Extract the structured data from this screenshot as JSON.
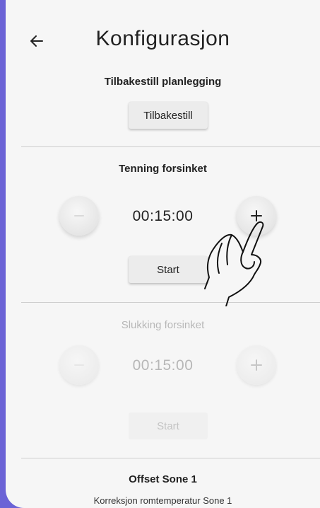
{
  "header": {
    "title": "Konfigurasjon"
  },
  "reset_schedule": {
    "title": "Tilbakestill planlegging",
    "button": "Tilbakestill"
  },
  "ignition_delay": {
    "title": "Tenning forsinket",
    "time": "00:15:00",
    "start": "Start"
  },
  "shutdown_delay": {
    "title": "Slukking forsinket",
    "time": "00:15:00",
    "start": "Start"
  },
  "offset": {
    "title": "Offset Sone 1",
    "subtitle": "Korreksjon romtemperatur Sone 1"
  },
  "colors": {
    "accent": "#6b63d6",
    "text": "#222222",
    "muted": "#b7b7b7",
    "background": "#f6f6f6"
  },
  "icons": [
    "back-arrow-icon",
    "minus-icon",
    "plus-icon",
    "hand-pointer-icon"
  ]
}
